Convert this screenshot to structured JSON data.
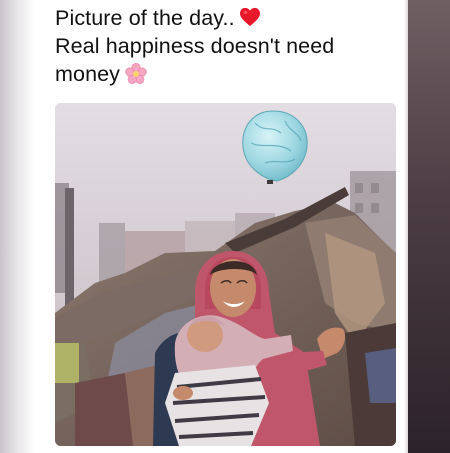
{
  "caption": {
    "line1": "Picture of the day..",
    "line2": "Real happiness doesn't need",
    "line3": "money"
  },
  "icons": {
    "heart": "red-heart-icon",
    "flower": "pink-flower-icon"
  },
  "colors": {
    "heart": "#e8182b",
    "flower": "#f4a6c2",
    "balloon": "#a9dde6",
    "scarf": "#c0566a"
  }
}
